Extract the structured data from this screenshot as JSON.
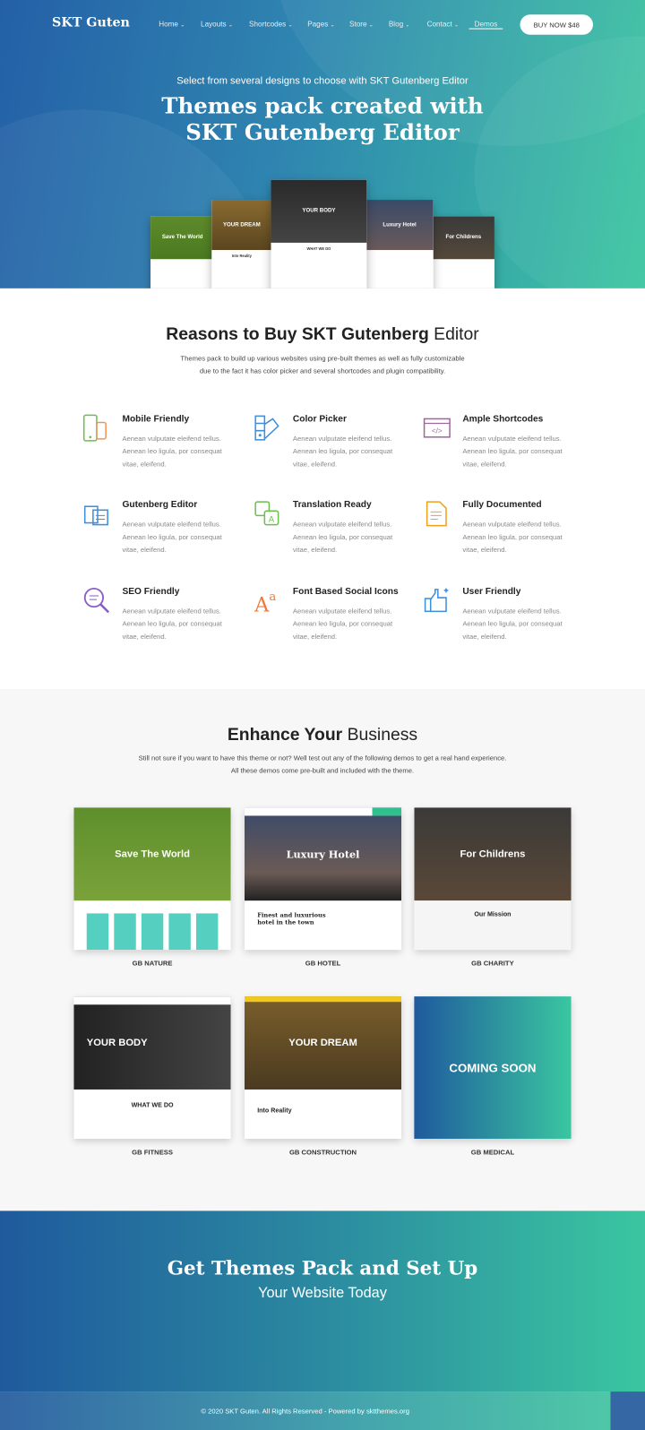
{
  "header": {
    "logo": "SKT Guten",
    "nav": [
      {
        "label": "Home",
        "chevron": true
      },
      {
        "label": "Layouts",
        "chevron": true
      },
      {
        "label": "Shortcodes",
        "chevron": true
      },
      {
        "label": "Pages",
        "chevron": true
      },
      {
        "label": "Store",
        "chevron": true
      },
      {
        "label": "Blog",
        "chevron": true
      },
      {
        "label": "Contact",
        "chevron": true
      },
      {
        "label": "Demos",
        "chevron": false,
        "active": true
      }
    ],
    "buy_button": "BUY NOW $48"
  },
  "hero": {
    "subtitle": "Select from several designs to choose with SKT Gutenberg Editor",
    "title_line1": "Themes pack created with",
    "title_line2": "SKT Gutenberg Editor",
    "mockups": [
      "Save The World",
      "YOUR DREAM",
      "YOUR BODY",
      "Luxury Hotel",
      "For Childrens"
    ],
    "mockup_sub": [
      "",
      "Into Reality",
      "WHAT WE DO",
      "",
      ""
    ]
  },
  "reasons": {
    "title_bold": "Reasons to Buy SKT Gutenberg",
    "title_light": "Editor",
    "desc_line1": "Themes pack to build up various websites using pre-built themes as well as fully customizable",
    "desc_line2": "due to the fact it has color picker and several shortcodes and plugin compatibility.",
    "features": [
      {
        "title": "Mobile Friendly",
        "desc": "Aenean vulputate eleifend tellus. Aenean leo ligula, por consequat vitae, eleifend.",
        "icon": "mobile-icon"
      },
      {
        "title": "Color Picker",
        "desc": "Aenean vulputate eleifend tellus. Aenean leo ligula, por consequat vitae, eleifend.",
        "icon": "color-picker-icon"
      },
      {
        "title": "Ample Shortcodes",
        "desc": "Aenean vulputate eleifend tellus. Aenean leo ligula, por consequat vitae, eleifend.",
        "icon": "code-icon"
      },
      {
        "title": "Gutenberg Editor",
        "desc": "Aenean vulputate eleifend tellus. Aenean leo ligula, por consequat vitae, eleifend.",
        "icon": "editor-icon"
      },
      {
        "title": "Translation Ready",
        "desc": "Aenean vulputate eleifend tellus. Aenean leo ligula, por consequat vitae, eleifend.",
        "icon": "translation-icon"
      },
      {
        "title": "Fully Documented",
        "desc": "Aenean vulputate eleifend tellus. Aenean leo ligula, por consequat vitae, eleifend.",
        "icon": "document-icon"
      },
      {
        "title": "SEO Friendly",
        "desc": "Aenean vulputate eleifend tellus. Aenean leo ligula, por consequat vitae, eleifend.",
        "icon": "seo-search-icon"
      },
      {
        "title": "Font Based Social Icons",
        "desc": "Aenean vulputate eleifend tellus. Aenean leo ligula, por consequat vitae, eleifend.",
        "icon": "font-icon"
      },
      {
        "title": "User Friendly",
        "desc": "Aenean vulputate eleifend tellus. Aenean leo ligula, por consequat vitae, eleifend.",
        "icon": "thumbs-up-icon"
      }
    ]
  },
  "business": {
    "title_bold": "Enhance Your",
    "title_light": "Business",
    "desc_line1": "Still not sure if you want to have this theme or not? Well test out any of the following demos to get a real hand experience.",
    "desc_line2": "All these demos come pre-built and included with the theme.",
    "demos": [
      {
        "label": "GB NATURE",
        "heading": "Save The World",
        "body": ""
      },
      {
        "label": "GB HOTEL",
        "heading": "Luxury Hotel",
        "body": "Finest and luxurious hotel in the town"
      },
      {
        "label": "GB CHARITY",
        "heading": "For Childrens",
        "body": "Our Mission"
      },
      {
        "label": "GB FITNESS",
        "heading": "YOUR BODY",
        "body": "WHAT WE DO"
      },
      {
        "label": "GB CONSTRUCTION",
        "heading": "YOUR DREAM",
        "body": "Into Reality"
      },
      {
        "label": "GB MEDICAL",
        "heading": "COMING SOON",
        "body": ""
      }
    ]
  },
  "cta": {
    "title": "Get Themes Pack and Set Up",
    "subtitle": "Your Website Today"
  },
  "footer": {
    "copyright": "© 2020 SKT Guten. All Rights Reserved - Powered by sktthemes.org"
  },
  "colors": {
    "gradient_start": "#2460a7",
    "gradient_end": "#3cc6a1",
    "section_bg": "#f7f7f7"
  }
}
